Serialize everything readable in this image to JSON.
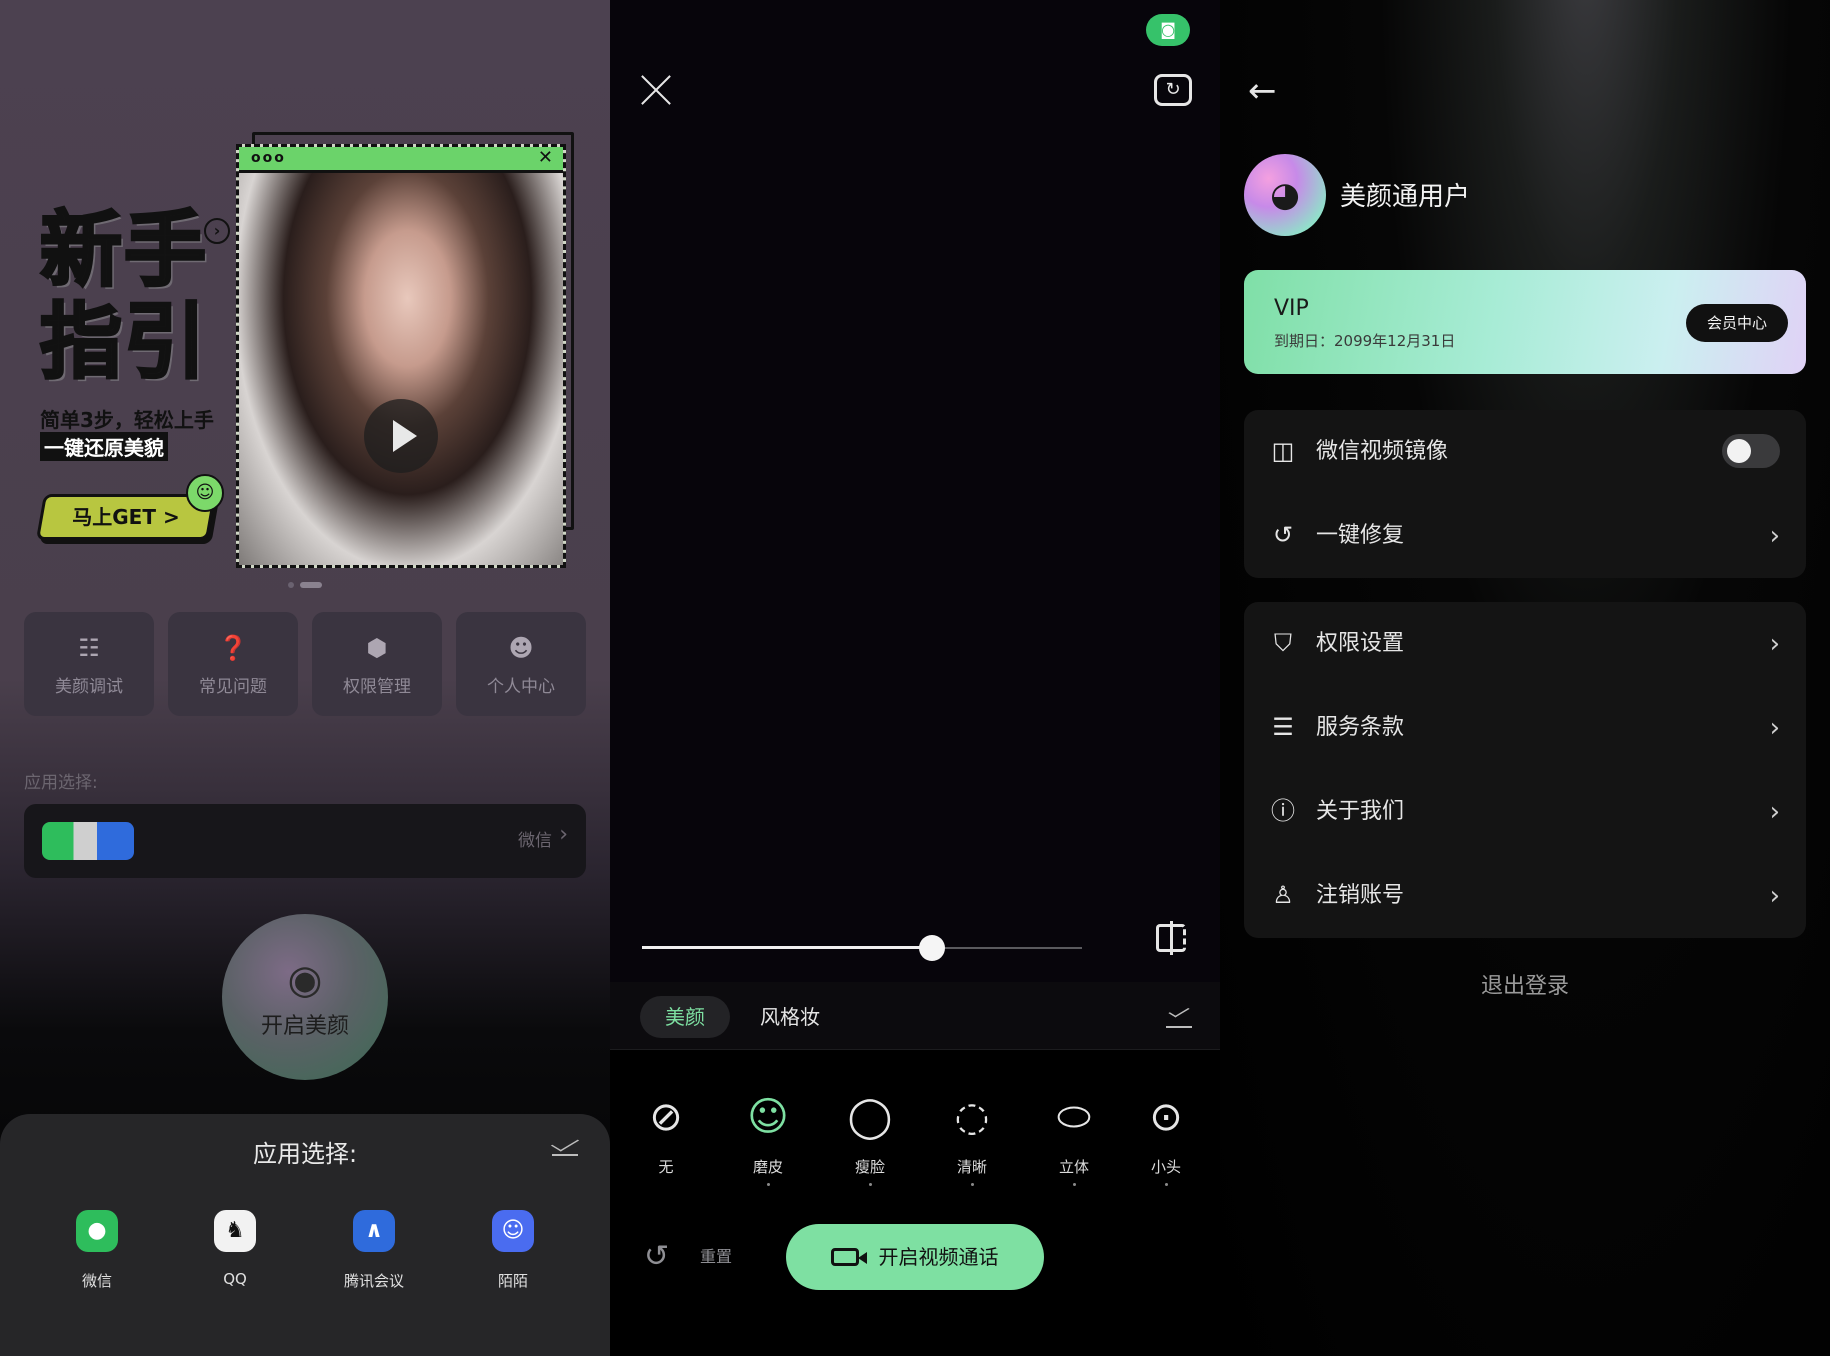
{
  "home": {
    "banner": {
      "title": "新手指引",
      "sub1": "简单3步，轻松上手",
      "sub2": "一键还原美貌",
      "cta": "马上GET >"
    },
    "tiles": [
      {
        "label": "美颜调试",
        "icon": "beauty-debug-icon"
      },
      {
        "label": "常见问题",
        "icon": "faq-icon"
      },
      {
        "label": "权限管理",
        "icon": "permission-icon"
      },
      {
        "label": "个人中心",
        "icon": "profile-icon"
      }
    ],
    "app_select_label": "应用选择:",
    "app_select_value": "微信",
    "start_label": "开启美颜",
    "sheet": {
      "title": "应用选择:",
      "apps": [
        {
          "label": "微信",
          "color": "#2ebd5c"
        },
        {
          "label": "QQ",
          "color": "#f2f2f2"
        },
        {
          "label": "腾讯会议",
          "color": "#2f6bdc"
        },
        {
          "label": "陌陌",
          "color": "#4a6cf0"
        }
      ]
    }
  },
  "camera": {
    "slider_value": 0.66,
    "tabs": [
      "美颜",
      "风格妆"
    ],
    "active_tab": "美颜",
    "effects": [
      {
        "label": "无",
        "icon": "none-icon"
      },
      {
        "label": "磨皮",
        "icon": "smooth-skin-icon",
        "selected": true
      },
      {
        "label": "瘦脸",
        "icon": "slim-face-icon"
      },
      {
        "label": "清晰",
        "icon": "clarity-icon"
      },
      {
        "label": "立体",
        "icon": "contour-icon"
      },
      {
        "label": "小头",
        "icon": "small-head-icon"
      }
    ],
    "reset_label": "重置",
    "call_label": "开启视频通话",
    "accent": "#7ee0a2"
  },
  "profile": {
    "username": "美颜通用户",
    "vip": {
      "title": "VIP",
      "expiry": "到期日：2099年12月31日",
      "button": "会员中心"
    },
    "group1": [
      {
        "label": "微信视频镜像",
        "icon": "mirror-icon",
        "toggle": false
      },
      {
        "label": "一键修复",
        "icon": "refresh-icon"
      }
    ],
    "group2": [
      {
        "label": "权限设置",
        "icon": "shield-icon"
      },
      {
        "label": "服务条款",
        "icon": "document-icon"
      },
      {
        "label": "关于我们",
        "icon": "info-icon"
      },
      {
        "label": "注销账号",
        "icon": "user-icon"
      }
    ],
    "logout": "退出登录"
  }
}
